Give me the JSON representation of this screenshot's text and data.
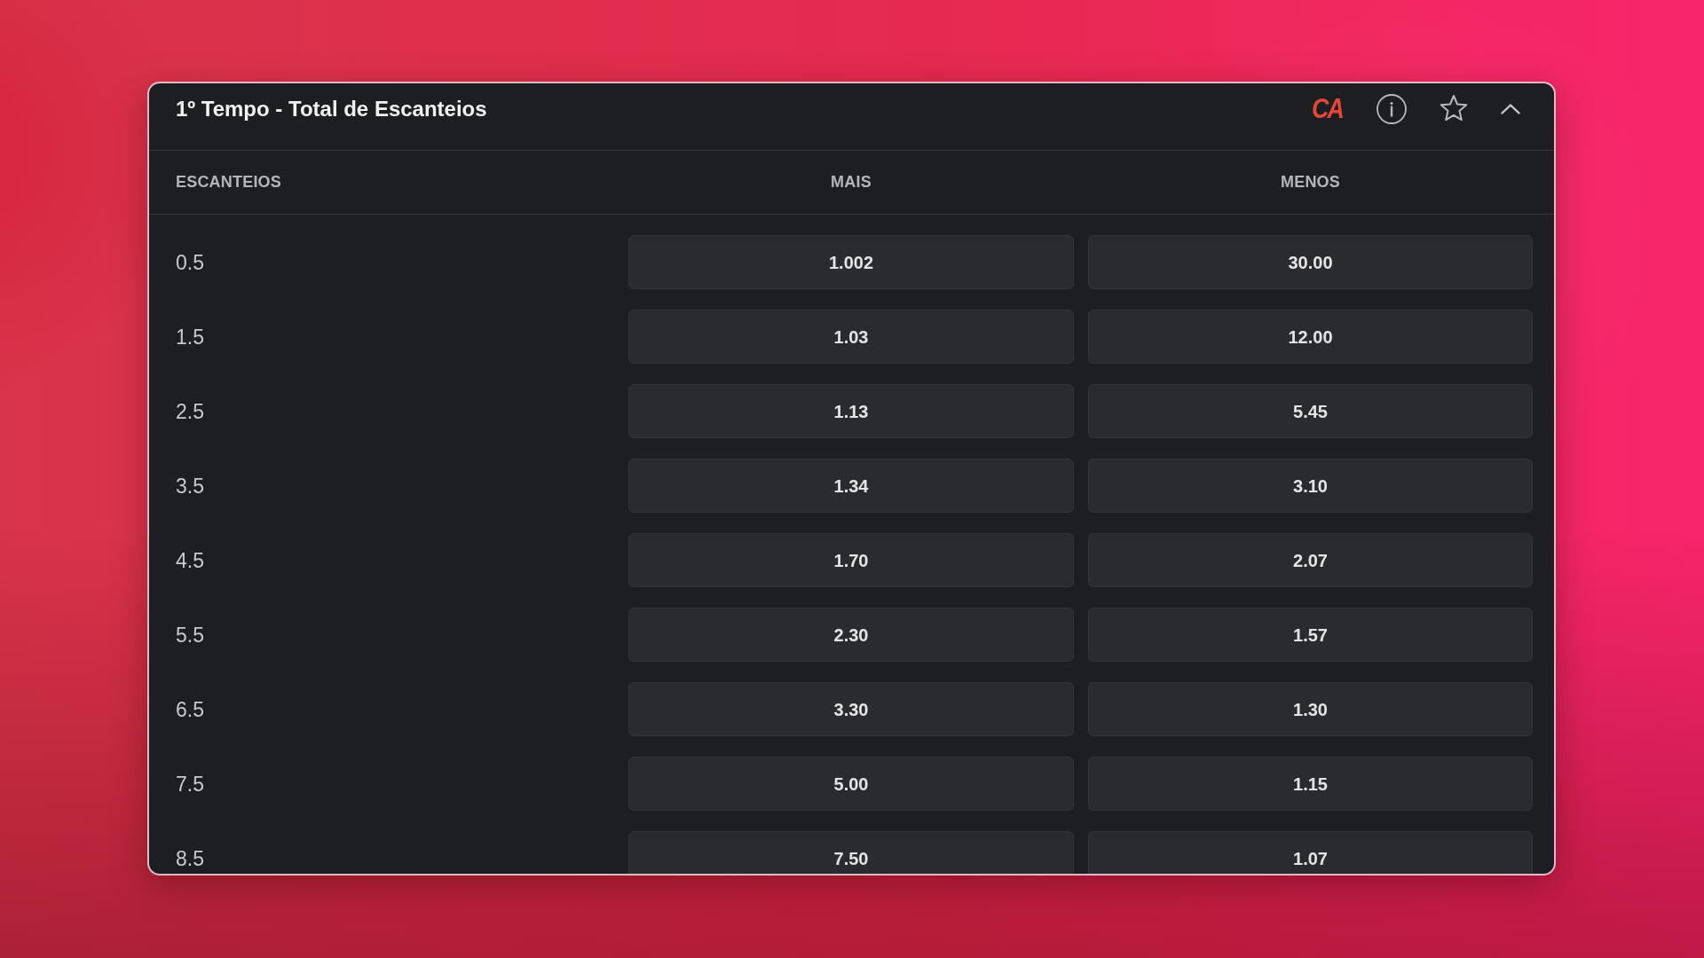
{
  "market": {
    "title": "1º Tempo - Total de Escanteios",
    "logo": "CA",
    "favorited": false,
    "expanded": true,
    "columns": [
      "ESCANTEIOS",
      "MAIS",
      "MENOS"
    ],
    "rows": [
      {
        "line": "0.5",
        "odds": [
          {
            "value": "1.002",
            "selected": false
          },
          {
            "value": "30.00",
            "selected": false
          }
        ]
      },
      {
        "line": "1.5",
        "odds": [
          {
            "value": "1.03",
            "selected": false
          },
          {
            "value": "12.00",
            "selected": false
          }
        ]
      },
      {
        "line": "2.5",
        "odds": [
          {
            "value": "1.13",
            "selected": false
          },
          {
            "value": "5.45",
            "selected": false
          }
        ]
      },
      {
        "line": "3.5",
        "odds": [
          {
            "value": "1.34",
            "selected": false
          },
          {
            "value": "3.10",
            "selected": false
          }
        ]
      },
      {
        "line": "4.5",
        "odds": [
          {
            "value": "1.70",
            "selected": false
          },
          {
            "value": "2.07",
            "selected": false
          }
        ]
      },
      {
        "line": "5.5",
        "odds": [
          {
            "value": "2.30",
            "selected": false
          },
          {
            "value": "1.57",
            "selected": false
          }
        ]
      },
      {
        "line": "6.5",
        "odds": [
          {
            "value": "3.30",
            "selected": false
          },
          {
            "value": "1.30",
            "selected": false
          }
        ]
      },
      {
        "line": "7.5",
        "odds": [
          {
            "value": "5.00",
            "selected": false
          },
          {
            "value": "1.15",
            "selected": false
          }
        ]
      },
      {
        "line": "8.5",
        "odds": [
          {
            "value": "7.50",
            "selected": false
          },
          {
            "value": "1.07",
            "selected": false
          }
        ]
      }
    ]
  }
}
